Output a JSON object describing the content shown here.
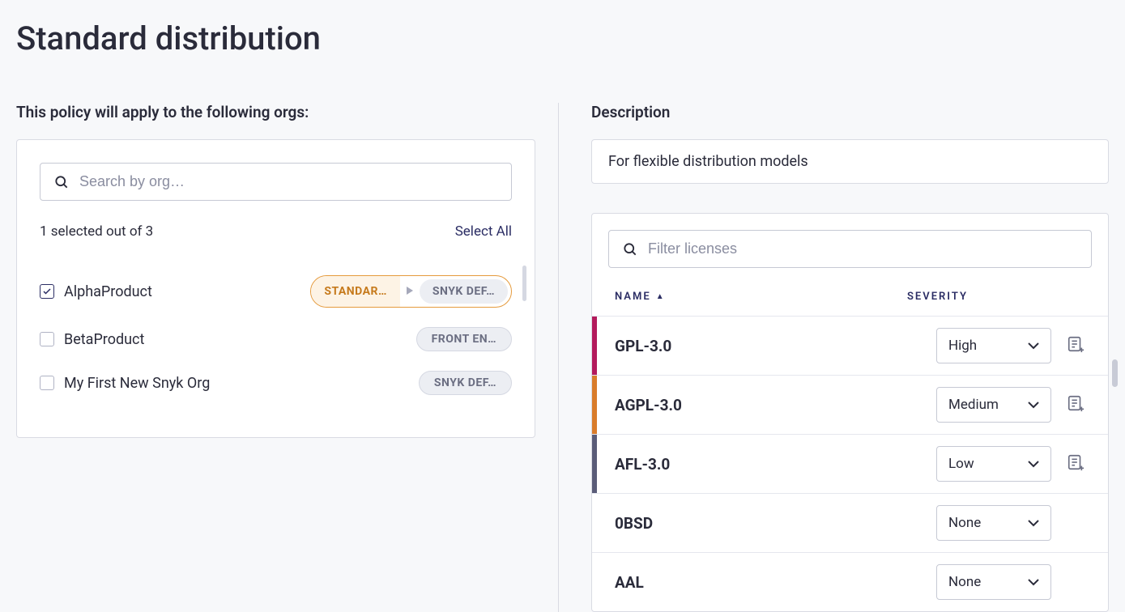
{
  "page_title": "Standard distribution",
  "orgs_section": {
    "label": "This policy will apply to the following orgs:",
    "search_placeholder": "Search by org…",
    "selected_count_text": "1 selected out of 3",
    "select_all_label": "Select All",
    "items": [
      {
        "name": "AlphaProduct",
        "checked": true,
        "badge_primary": "STANDAR…",
        "badge_secondary": "SNYK DEF…"
      },
      {
        "name": "BetaProduct",
        "checked": false,
        "badge_single": "FRONT EN…"
      },
      {
        "name": "My First New Snyk Org",
        "checked": false,
        "badge_single": "SNYK DEF…"
      }
    ]
  },
  "description": {
    "label": "Description",
    "value": "For flexible distribution models"
  },
  "licenses": {
    "filter_placeholder": "Filter licenses",
    "col_name": "NAME",
    "col_severity": "SEVERITY",
    "rows": [
      {
        "name": "GPL-3.0",
        "severity": "High",
        "sev_class": "sev-high",
        "has_note": true
      },
      {
        "name": "AGPL-3.0",
        "severity": "Medium",
        "sev_class": "sev-medium",
        "has_note": true
      },
      {
        "name": "AFL-3.0",
        "severity": "Low",
        "sev_class": "sev-low",
        "has_note": true
      },
      {
        "name": "0BSD",
        "severity": "None",
        "sev_class": "sev-none",
        "has_note": false
      },
      {
        "name": "AAL",
        "severity": "None",
        "sev_class": "sev-none",
        "has_note": false
      }
    ]
  }
}
